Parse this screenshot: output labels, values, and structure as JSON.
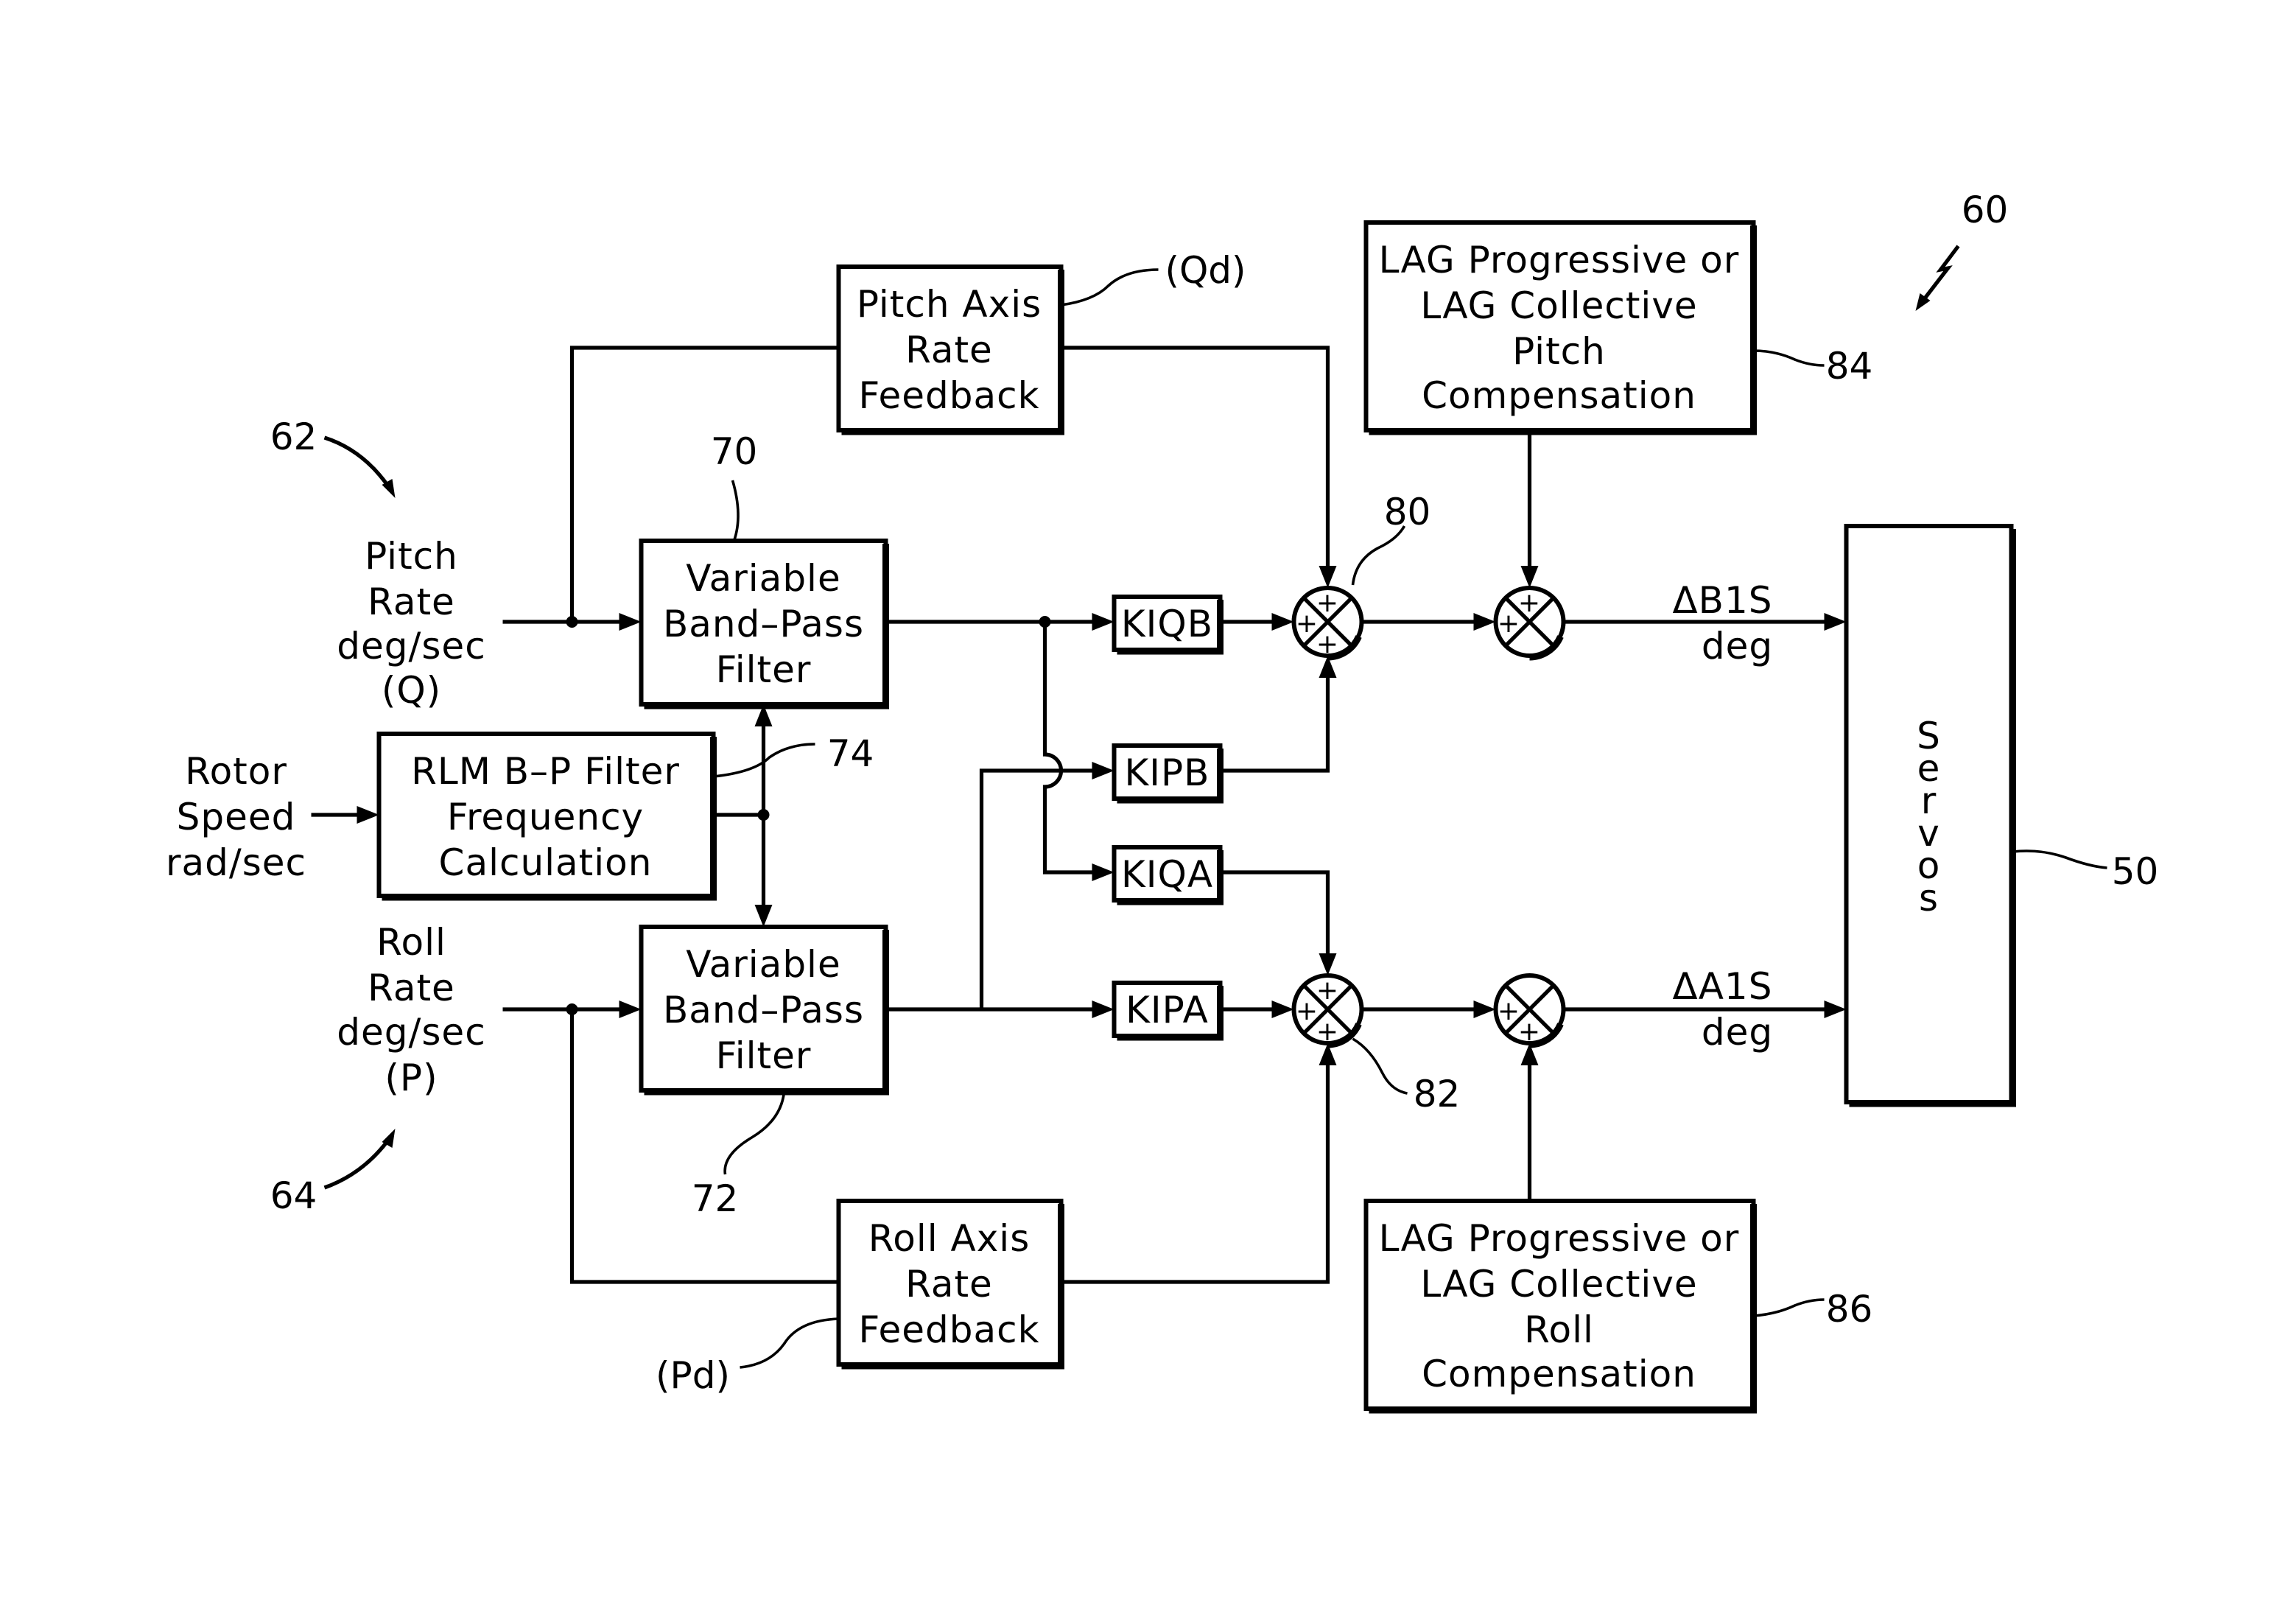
{
  "figure": {
    "ref_number": "60",
    "inputs": {
      "pitch_rate": {
        "lines": [
          "Pitch",
          "Rate",
          "deg/sec",
          "(Q)"
        ],
        "ref": "62"
      },
      "roll_rate": {
        "lines": [
          "Roll",
          "Rate",
          "deg/sec",
          "(P)"
        ],
        "ref": "64"
      },
      "rotor_speed": {
        "lines": [
          "Rotor",
          "Speed",
          "rad/sec"
        ]
      }
    },
    "blocks": {
      "pitch_feedback": {
        "lines": [
          "Pitch  Axis",
          "Rate",
          "Feedback"
        ],
        "tag": "(Qd)"
      },
      "roll_feedback": {
        "lines": [
          "Roll  Axis",
          "Rate",
          "Feedback"
        ],
        "tag": "(Pd)"
      },
      "bpf_pitch": {
        "lines": [
          "Variable",
          "Band–Pass",
          "Filter"
        ],
        "ref": "70"
      },
      "bpf_roll": {
        "lines": [
          "Variable",
          "Band–Pass",
          "Filter"
        ],
        "ref": "72"
      },
      "rlm_calc": {
        "lines": [
          "RLM  B–P  Filter",
          "Frequency",
          "Calculation"
        ],
        "ref": "74"
      },
      "lag_pitch": {
        "lines": [
          "LAG  Progressive  or",
          "LAG  Collective",
          "Pitch",
          "Compensation"
        ],
        "ref": "84"
      },
      "lag_roll": {
        "lines": [
          "LAG  Progressive  or",
          "LAG  Collective",
          "Roll",
          "Compensation"
        ],
        "ref": "86"
      },
      "servos": {
        "letters": [
          "S",
          "e",
          "r",
          "v",
          "o",
          "s"
        ],
        "ref": "50"
      }
    },
    "gains": {
      "kiqb": "KIQB",
      "kipb": "KIPB",
      "kiqa": "KIQA",
      "kipa": "KIPA"
    },
    "summers": {
      "sum_pitch": {
        "ref": "80",
        "signs": [
          "+",
          "+",
          "+"
        ]
      },
      "sum_roll": {
        "ref": "82",
        "signs": [
          "+",
          "+",
          "+"
        ]
      },
      "sum_pitch_lag": {
        "signs": [
          "+",
          "+"
        ]
      },
      "sum_roll_lag": {
        "signs": [
          "+",
          "+"
        ]
      }
    },
    "outputs": {
      "b1s": {
        "lines": [
          "ΔB1S",
          "deg"
        ]
      },
      "a1s": {
        "lines": [
          "ΔA1S",
          "deg"
        ]
      }
    }
  }
}
